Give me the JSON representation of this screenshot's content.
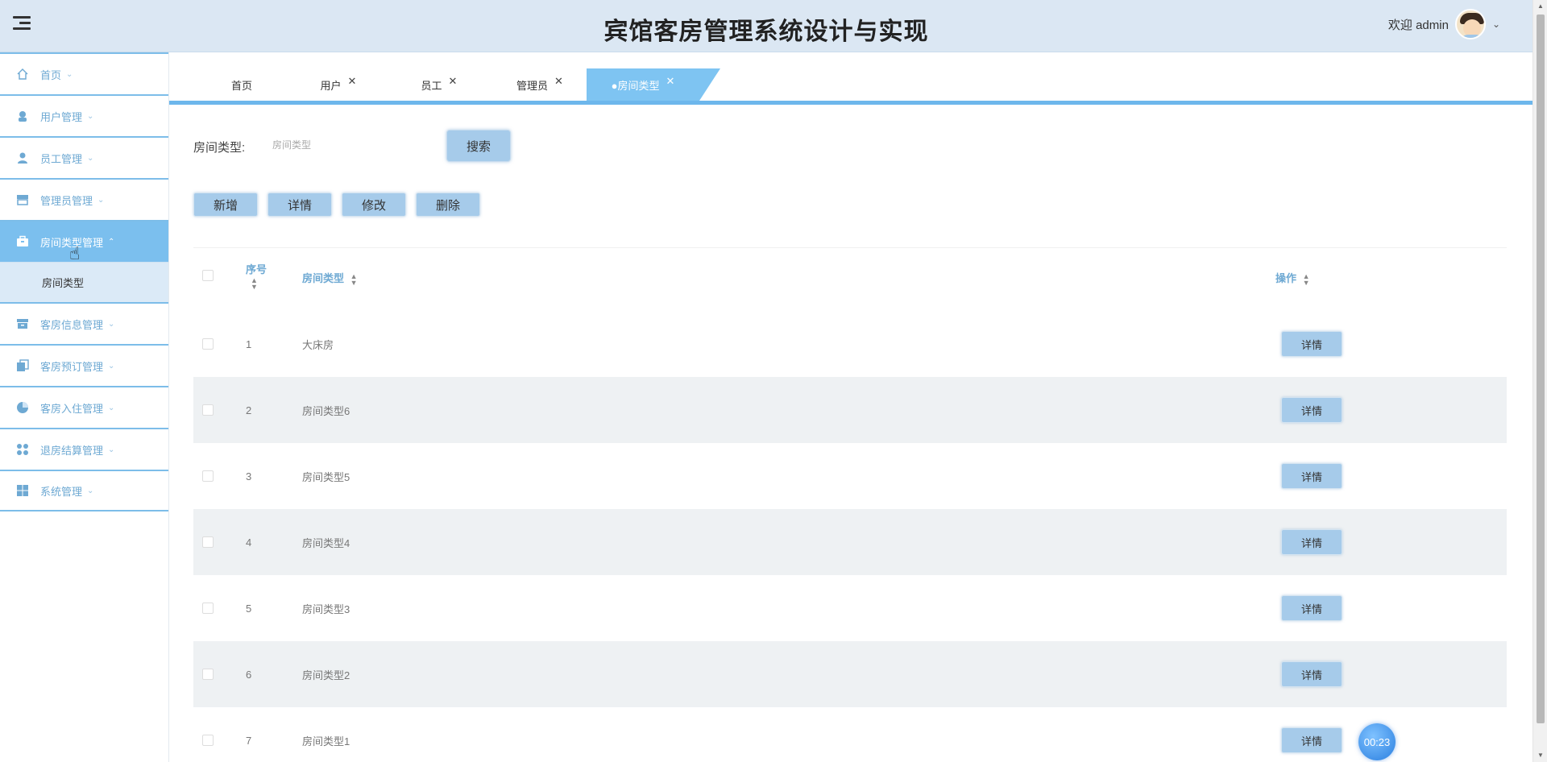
{
  "header": {
    "title": "宾馆客房管理系统设计与实现",
    "welcome": "欢迎 admin"
  },
  "sidebar": {
    "items": [
      {
        "label": "首页",
        "icon": "home-icon"
      },
      {
        "label": "用户管理",
        "icon": "user-icon"
      },
      {
        "label": "员工管理",
        "icon": "person-icon"
      },
      {
        "label": "管理员管理",
        "icon": "store-icon"
      },
      {
        "label": "房间类型管理",
        "icon": "briefcase-icon",
        "active": true,
        "sub": [
          "房间类型"
        ]
      },
      {
        "label": "客房信息管理",
        "icon": "archive-icon"
      },
      {
        "label": "客房预订管理",
        "icon": "copy-icon"
      },
      {
        "label": "客房入住管理",
        "icon": "pie-icon"
      },
      {
        "label": "退房结算管理",
        "icon": "grid-icon"
      },
      {
        "label": "系统管理",
        "icon": "windows-icon"
      }
    ]
  },
  "tabs": [
    {
      "label": "首页",
      "closable": false
    },
    {
      "label": "用户",
      "closable": true
    },
    {
      "label": "员工",
      "closable": true
    },
    {
      "label": "管理员",
      "closable": true
    },
    {
      "label": "●房间类型",
      "closable": true,
      "active": true
    }
  ],
  "search": {
    "label": "房间类型:",
    "placeholder": "房间类型",
    "button": "搜索"
  },
  "actions": {
    "add": "新增",
    "detail": "详情",
    "edit": "修改",
    "delete": "删除"
  },
  "table": {
    "headers": {
      "index": "序号",
      "type": "房间类型",
      "op": "操作"
    },
    "rows": [
      {
        "index": "1",
        "type": "大床房",
        "op": "详情"
      },
      {
        "index": "2",
        "type": "房间类型6",
        "op": "详情"
      },
      {
        "index": "3",
        "type": "房间类型5",
        "op": "详情"
      },
      {
        "index": "4",
        "type": "房间类型4",
        "op": "详情"
      },
      {
        "index": "5",
        "type": "房间类型3",
        "op": "详情"
      },
      {
        "index": "6",
        "type": "房间类型2",
        "op": "详情"
      },
      {
        "index": "7",
        "type": "房间类型1",
        "op": "详情"
      }
    ]
  },
  "timer": "00:23",
  "colors": {
    "accent": "#7bbfee",
    "header_bg": "#dbe7f3",
    "button": "#a6cbea"
  }
}
